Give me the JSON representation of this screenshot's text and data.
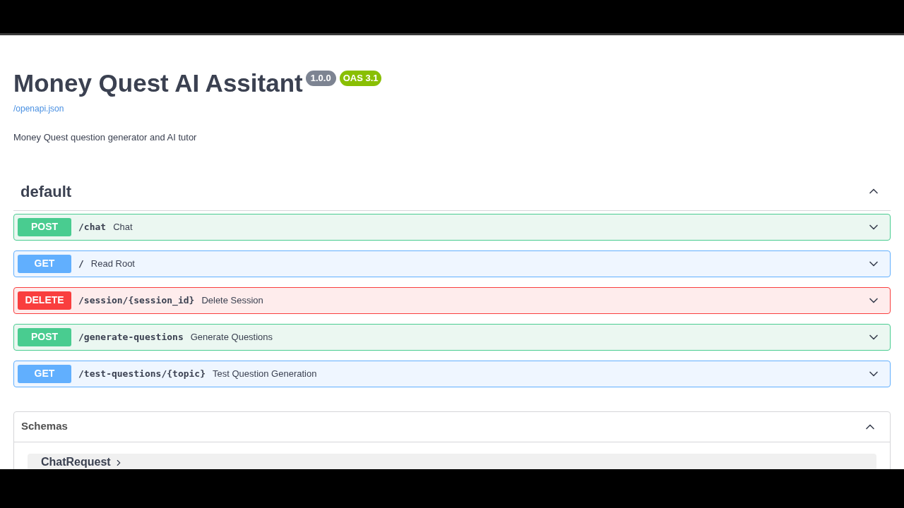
{
  "info": {
    "title": "Money Quest AI Assitant",
    "version": "1.0.0",
    "oas": "OAS 3.1",
    "spec_link": "/openapi.json",
    "description": "Money Quest question generator and AI tutor"
  },
  "tag": {
    "name": "default",
    "expanded": true
  },
  "operations": [
    {
      "method": "POST",
      "path": "/chat",
      "summary": "Chat",
      "expanded": false
    },
    {
      "method": "GET",
      "path": "/",
      "summary": "Read Root",
      "expanded": false
    },
    {
      "method": "DELETE",
      "path": "/session/{session_id}",
      "summary": "Delete Session",
      "expanded": false
    },
    {
      "method": "POST",
      "path": "/generate-questions",
      "summary": "Generate Questions",
      "expanded": false
    },
    {
      "method": "GET",
      "path": "/test-questions/{topic}",
      "summary": "Test Question Generation",
      "expanded": false
    }
  ],
  "schemas": {
    "title": "Schemas",
    "expanded": true,
    "items": [
      {
        "name": "ChatRequest"
      }
    ]
  }
}
